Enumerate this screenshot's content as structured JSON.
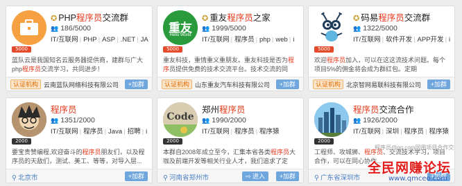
{
  "groups": [
    {
      "name_prefix": "PHP",
      "name_highlight": "程序员",
      "name_suffix": "交流群",
      "members": "186/5000",
      "badge": "5000",
      "tags": [
        "IT/互联网",
        "PHP",
        "ASP",
        ".NET",
        "JA"
      ],
      "desc_a": "蓝队云是我国知名云服务器提供商，建群与广大ph",
      "desc_b": "p",
      "desc_hl": "程序员",
      "desc_c": "交流学习，共同进步！",
      "cert": "认证机构",
      "org": "云南蓝队网络科技有限公司",
      "button": "+加群"
    },
    {
      "name_prefix": "重友",
      "name_highlight": "程序员",
      "name_suffix": "之家",
      "members": "1999/5000",
      "badge": "5000",
      "avatar_text": "重友",
      "avatar_sub": "Hello World",
      "tags": [
        "IT/互联网",
        "程序员",
        "php",
        "web",
        "i"
      ],
      "desc_a": "重友科技，重情重义重朋友。重友科技是否为",
      "desc_hl": "程序",
      "desc_b": "员",
      "desc_c": "提供免费的技术交流平台。技术交流的同时，",
      "cert": "认证机构",
      "org": "山东重友汽车科技有限公司",
      "button": "+加群"
    },
    {
      "name_prefix": "码易",
      "name_highlight": "程序员",
      "name_suffix": "交流群",
      "members": "1322/5000",
      "badge": "5000",
      "tags": [
        "IT/互联网",
        "软件开发",
        "APP开发",
        "i"
      ],
      "desc_a": "欢迎",
      "desc_hl": "程序员",
      "desc_b": "加入，",
      "desc_c": "可以在这这流技术问题。每个项目5%的佣金将会成为群红包。定期",
      "cert": "认证机构",
      "org": "北京智网易联科技有限公司",
      "button": "+加群"
    },
    {
      "name_prefix": "",
      "name_highlight": "程序员",
      "name_suffix": "",
      "members": "1351/2000",
      "badge": "2000",
      "tags": [
        "IT/互联网",
        "程序员",
        "Java",
        "招聘",
        "i"
      ],
      "desc_a": "要宝贵赞编程,欢迎奋斗的",
      "desc_hl": "程序员",
      "desc_b": "朋友们，以及",
      "desc_c": "程序员的天敌们，测试、美工、等等，对导入层...",
      "location": "北京市",
      "button": "+加群"
    },
    {
      "name_prefix": "郑州",
      "name_highlight": "程序员",
      "name_suffix": "",
      "members": "1990/2000",
      "badge": "2000",
      "avatar_text": "Code",
      "tags": [
        "IT/互联网",
        "程序员",
        "程序猿"
      ],
      "desc_a": "本群自2008年成立至今，汇集本省各类",
      "desc_hl": "程序员",
      "desc_b": "大",
      "desc_c": "咖及前端开发等相关行业人才，我们追求了定期...",
      "location": "河南省郑州市",
      "button": "进入",
      "button2": "+加群"
    },
    {
      "name_prefix": "",
      "name_highlight": "程序员",
      "name_suffix": "交流合作",
      "members": "1926/2000",
      "badge": "2000",
      "tags": [
        "IT/互联网",
        "深圳",
        "程序员",
        "程序猿"
      ],
      "desc_a": "工程师、攻城狮、",
      "desc_hl": "程序员",
      "desc_b": "、",
      "desc_c": "交流技术学习，项目合作，可以在同心协作...",
      "location": "广东省深圳市",
      "button": "+加群"
    }
  ],
  "watermark": {
    "site_name": "全民网赚论坛",
    "site_url": "www.qmceo.com",
    "faint": "程序员@qq.com同用项目合作交"
  },
  "colors": {
    "highlight": "#e4391b",
    "button": "#6fa6de",
    "cert_bg": "#fbe4c8",
    "location": "#4a7ec2"
  }
}
